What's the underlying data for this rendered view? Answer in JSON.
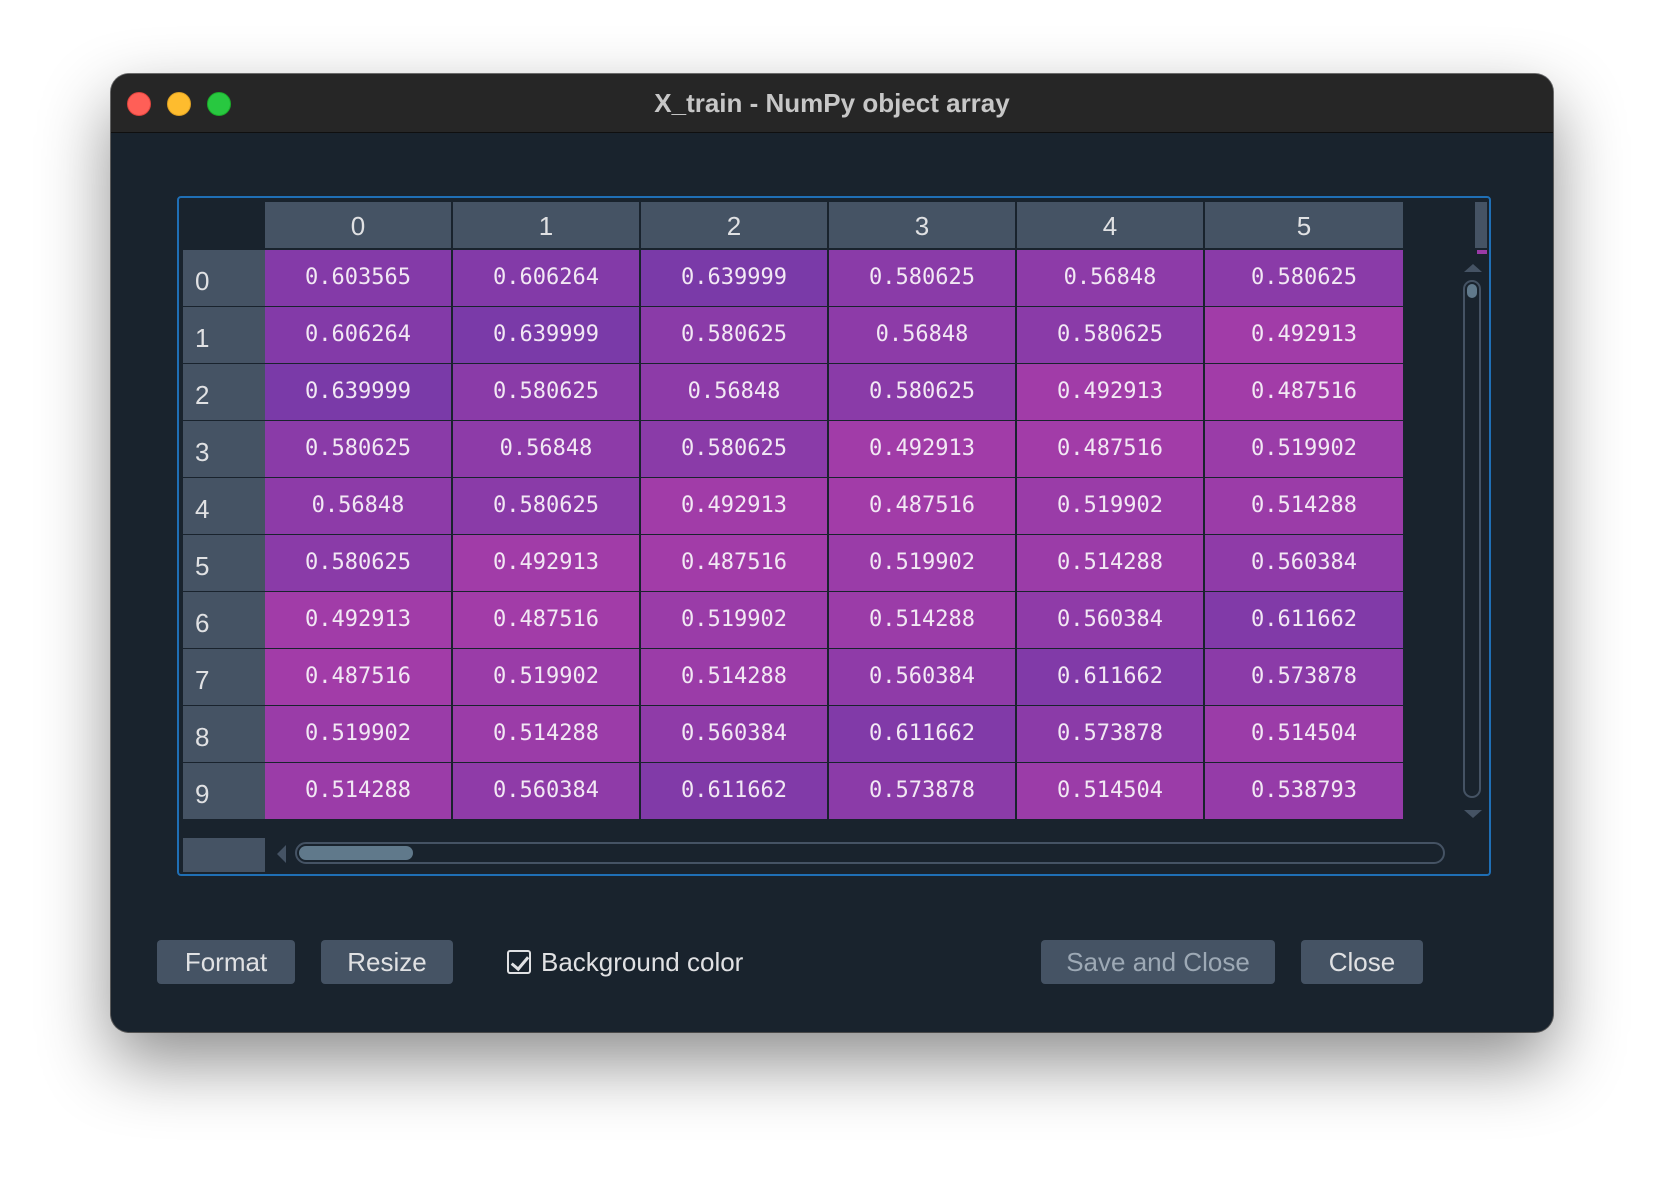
{
  "window": {
    "title": "X_train - NumPy object array"
  },
  "table": {
    "column_headers": [
      "0",
      "1",
      "2",
      "3",
      "4",
      "5"
    ],
    "row_headers": [
      "0",
      "1",
      "2",
      "3",
      "4",
      "5",
      "6",
      "7",
      "8",
      "9"
    ],
    "rows": [
      [
        "0.603565",
        "0.606264",
        "0.639999",
        "0.580625",
        "0.56848",
        "0.580625"
      ],
      [
        "0.606264",
        "0.639999",
        "0.580625",
        "0.56848",
        "0.580625",
        "0.492913"
      ],
      [
        "0.639999",
        "0.580625",
        "0.56848",
        "0.580625",
        "0.492913",
        "0.487516"
      ],
      [
        "0.580625",
        "0.56848",
        "0.580625",
        "0.492913",
        "0.487516",
        "0.519902"
      ],
      [
        "0.56848",
        "0.580625",
        "0.492913",
        "0.487516",
        "0.519902",
        "0.514288"
      ],
      [
        "0.580625",
        "0.492913",
        "0.487516",
        "0.519902",
        "0.514288",
        "0.560384"
      ],
      [
        "0.492913",
        "0.487516",
        "0.519902",
        "0.514288",
        "0.560384",
        "0.611662"
      ],
      [
        "0.487516",
        "0.519902",
        "0.514288",
        "0.560384",
        "0.611662",
        "0.573878"
      ],
      [
        "0.519902",
        "0.514288",
        "0.560384",
        "0.611662",
        "0.573878",
        "0.514504"
      ],
      [
        "0.514288",
        "0.560384",
        "0.611662",
        "0.573878",
        "0.514504",
        "0.538793"
      ]
    ],
    "color_scale": {
      "low_color": "#a23ca8",
      "high_color": "#7a3aa8"
    },
    "header_bg": "#455364",
    "frame_border_color": "#1f6fb5"
  },
  "toolbar": {
    "format_label": "Format",
    "resize_label": "Resize",
    "background_color_label": "Background color",
    "background_color_checked": true,
    "save_close_label": "Save and Close",
    "close_label": "Close"
  },
  "icons": {
    "close": "traffic-close-icon",
    "minimize": "traffic-minimize-icon",
    "maximize": "traffic-maximize-icon",
    "scroll_up": "triangle-up-icon",
    "scroll_down": "triangle-down-icon",
    "scroll_left": "triangle-left-icon",
    "checkmark": "checkmark-icon"
  },
  "colors": {
    "window_bg": "#19232d",
    "titlebar_bg": "#262626",
    "traffic_close": "#ff5f57",
    "traffic_minimize": "#febc2e",
    "traffic_maximize": "#28c840"
  }
}
